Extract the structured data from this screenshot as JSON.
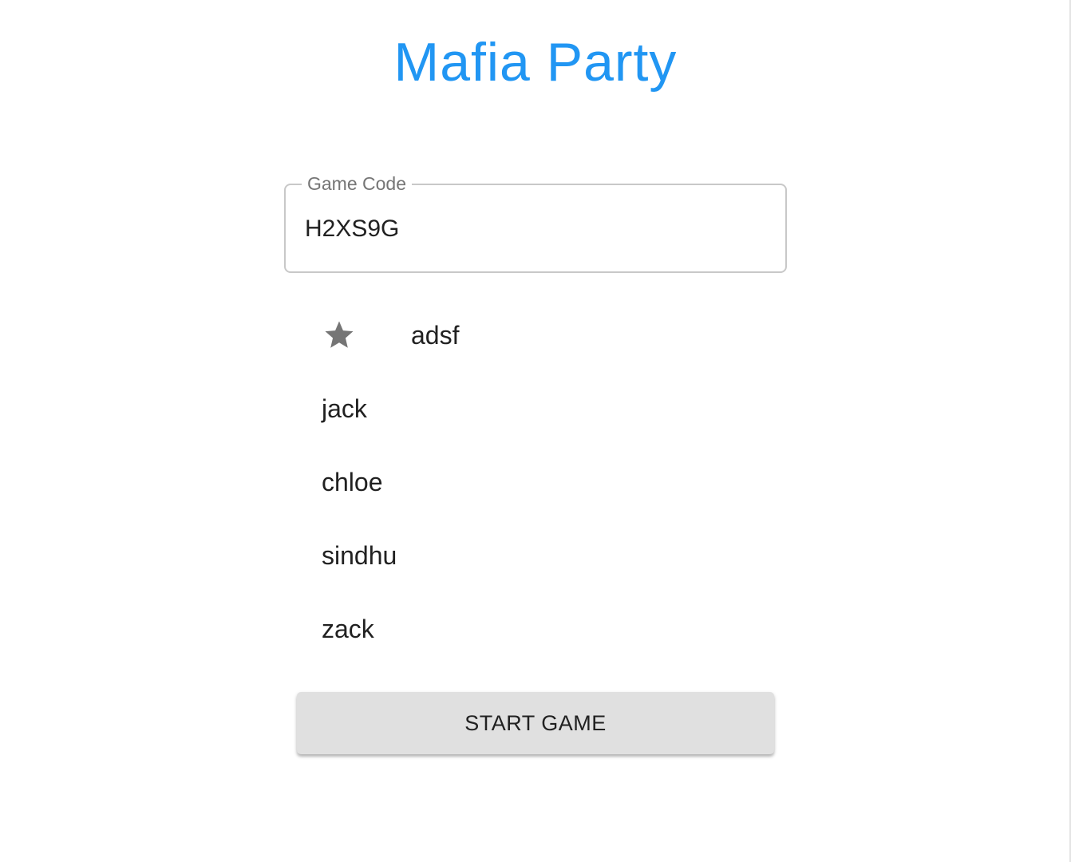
{
  "app": {
    "title": "Mafia Party"
  },
  "game_code": {
    "label": "Game Code",
    "value": "H2XS9G"
  },
  "players": [
    {
      "name": "adsf",
      "is_host": true,
      "icon": "star-icon"
    },
    {
      "name": "jack",
      "is_host": false
    },
    {
      "name": "chloe",
      "is_host": false
    },
    {
      "name": "sindhu",
      "is_host": false
    },
    {
      "name": "zack",
      "is_host": false
    }
  ],
  "actions": {
    "start_label": "START GAME"
  },
  "colors": {
    "title": "#2196f3",
    "button_bg": "#e0e0e0",
    "star": "#757575"
  }
}
